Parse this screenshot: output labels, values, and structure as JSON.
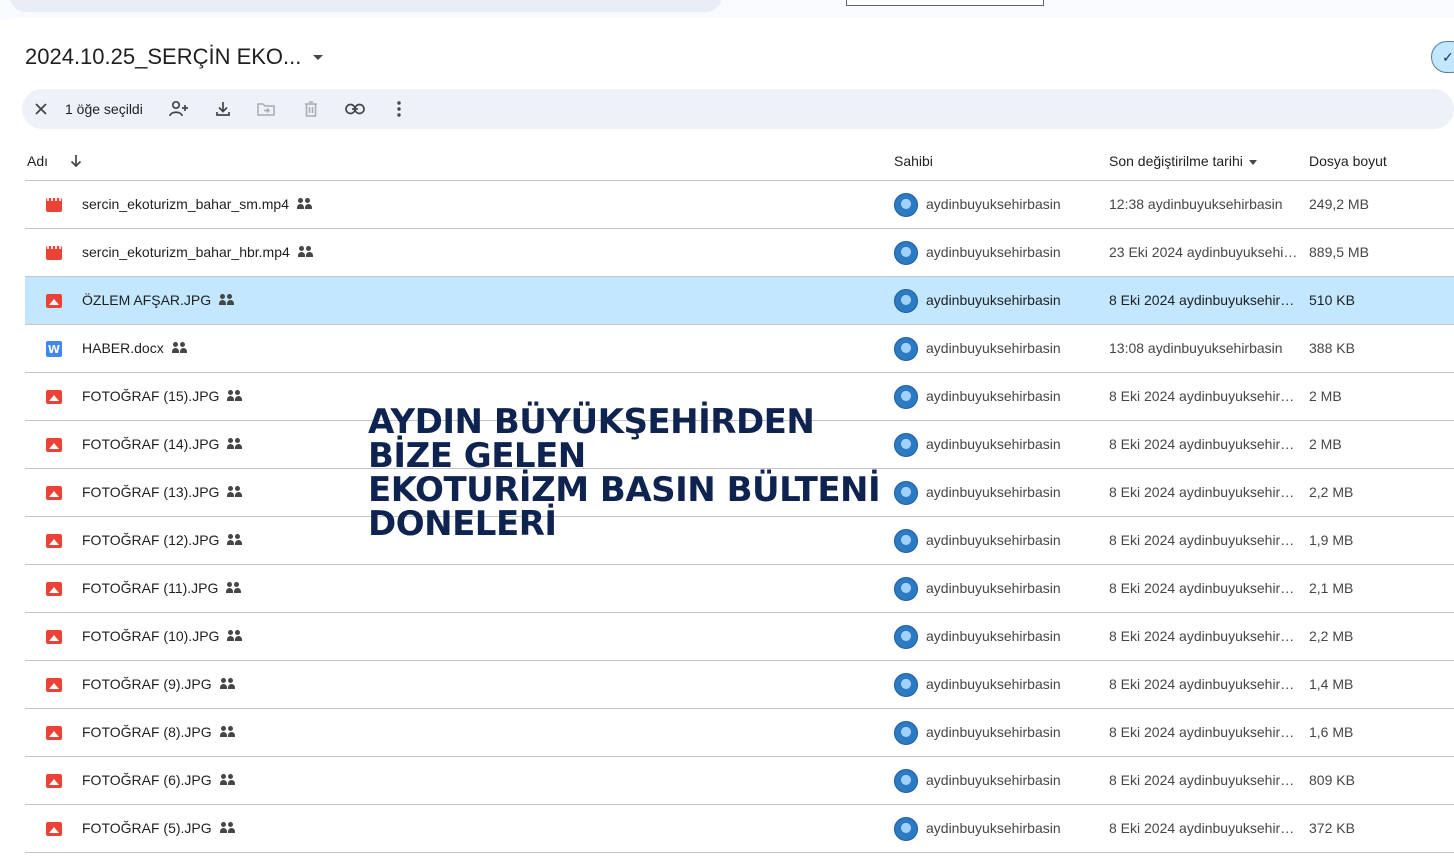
{
  "folder": {
    "title": "2024.10.25_SERÇİN EKO..."
  },
  "selection_bar": {
    "count_label": "1 öğe seçildi",
    "actions": [
      "close-icon",
      "share-icon",
      "download-icon",
      "move-icon",
      "trash-icon",
      "link-icon",
      "more-icon"
    ]
  },
  "columns": {
    "name": "Adı",
    "owner": "Sahibi",
    "modified": "Son değiştirilme tarihi",
    "size": "Dosya boyut"
  },
  "files": [
    {
      "name": "sercin_ekoturizm_bahar_sm.mp4",
      "type": "video",
      "owner": "aydinbuyuksehirbasin",
      "modified": "12:38  aydinbuyuksehirbasin",
      "size": "249,2 MB",
      "selected": false
    },
    {
      "name": "sercin_ekoturizm_bahar_hbr.mp4",
      "type": "video",
      "owner": "aydinbuyuksehirbasin",
      "modified": "23 Eki 2024  aydinbuyuksehi…",
      "size": "889,5 MB",
      "selected": false
    },
    {
      "name": "ÖZLEM AFŞAR.JPG",
      "type": "image",
      "owner": "aydinbuyuksehirbasin",
      "modified": "8 Eki 2024  aydinbuyuksehir…",
      "size": "510 KB",
      "selected": true
    },
    {
      "name": "HABER.docx",
      "type": "doc",
      "owner": "aydinbuyuksehirbasin",
      "modified": "13:08  aydinbuyuksehirbasin",
      "size": "388 KB",
      "selected": false
    },
    {
      "name": "FOTOĞRAF (15).JPG",
      "type": "image",
      "owner": "aydinbuyuksehirbasin",
      "modified": "8 Eki 2024  aydinbuyuksehir…",
      "size": "2 MB",
      "selected": false
    },
    {
      "name": "FOTOĞRAF (14).JPG",
      "type": "image",
      "owner": "aydinbuyuksehirbasin",
      "modified": "8 Eki 2024  aydinbuyuksehir…",
      "size": "2 MB",
      "selected": false
    },
    {
      "name": "FOTOĞRAF (13).JPG",
      "type": "image",
      "owner": "aydinbuyuksehirbasin",
      "modified": "8 Eki 2024  aydinbuyuksehir…",
      "size": "2,2 MB",
      "selected": false
    },
    {
      "name": "FOTOĞRAF (12).JPG",
      "type": "image",
      "owner": "aydinbuyuksehirbasin",
      "modified": "8 Eki 2024  aydinbuyuksehir…",
      "size": "1,9 MB",
      "selected": false
    },
    {
      "name": "FOTOĞRAF (11).JPG",
      "type": "image",
      "owner": "aydinbuyuksehirbasin",
      "modified": "8 Eki 2024  aydinbuyuksehir…",
      "size": "2,1 MB",
      "selected": false
    },
    {
      "name": "FOTOĞRAF (10).JPG",
      "type": "image",
      "owner": "aydinbuyuksehirbasin",
      "modified": "8 Eki 2024  aydinbuyuksehir…",
      "size": "2,2 MB",
      "selected": false
    },
    {
      "name": "FOTOĞRAF (9).JPG",
      "type": "image",
      "owner": "aydinbuyuksehirbasin",
      "modified": "8 Eki 2024  aydinbuyuksehir…",
      "size": "1,4 MB",
      "selected": false
    },
    {
      "name": "FOTOĞRAF (8).JPG",
      "type": "image",
      "owner": "aydinbuyuksehirbasin",
      "modified": "8 Eki 2024  aydinbuyuksehir…",
      "size": "1,6 MB",
      "selected": false
    },
    {
      "name": "FOTOĞRAF (6).JPG",
      "type": "image",
      "owner": "aydinbuyuksehirbasin",
      "modified": "8 Eki 2024  aydinbuyuksehir…",
      "size": "809 KB",
      "selected": false
    },
    {
      "name": "FOTOĞRAF (5).JPG",
      "type": "image",
      "owner": "aydinbuyuksehirbasin",
      "modified": "8 Eki 2024  aydinbuyuksehir…",
      "size": "372 KB",
      "selected": false
    }
  ],
  "overlay_caption": {
    "lines": [
      "AYDIN BÜYÜKŞEHİRDEN",
      "BİZE GELEN",
      "EKOTURİZM BASIN BÜLTENİ",
      "DONELERİ"
    ],
    "color": "#0f2350"
  },
  "colors": {
    "selected_row": "#c2e7ff",
    "selection_bar": "#edf1f8",
    "file_red": "#ea4335",
    "doc_blue": "#4285f4"
  }
}
